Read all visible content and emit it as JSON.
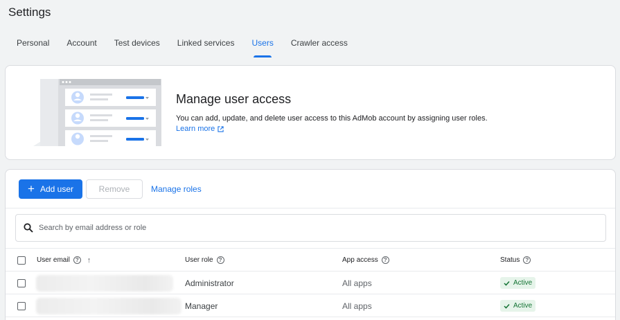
{
  "page": {
    "title": "Settings"
  },
  "tabs": [
    {
      "label": "Personal"
    },
    {
      "label": "Account"
    },
    {
      "label": "Test devices"
    },
    {
      "label": "Linked services"
    },
    {
      "label": "Users",
      "active": true
    },
    {
      "label": "Crawler access"
    }
  ],
  "hero": {
    "title": "Manage user access",
    "description": "You can add, update, and delete user access to this AdMob account by assigning user roles.",
    "link_label": "Learn more"
  },
  "toolbar": {
    "add_user_label": "Add user",
    "remove_label": "Remove",
    "manage_roles_label": "Manage roles"
  },
  "search": {
    "placeholder": "Search by email address or role",
    "value": ""
  },
  "table": {
    "headers": {
      "email": "User email",
      "role": "User role",
      "app_access": "App access",
      "status": "Status"
    },
    "rows": [
      {
        "email": "",
        "role": "Administrator",
        "app_access": "All apps",
        "status": "Active"
      },
      {
        "email": "",
        "role": "Manager",
        "app_access": "All apps",
        "status": "Active"
      }
    ]
  },
  "colors": {
    "accent": "#1a73e8",
    "active_chip_bg": "#e6f4ea",
    "active_chip_text": "#137333"
  }
}
